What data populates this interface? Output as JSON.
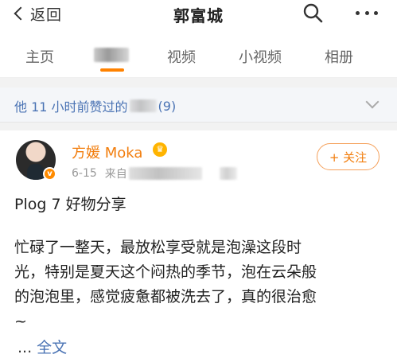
{
  "nav": {
    "back_label": "返回",
    "title": "郭富城",
    "icons": [
      "chevron-left-icon",
      "search-icon",
      "more-icon"
    ]
  },
  "tabs": [
    {
      "label": "主页"
    },
    {
      "label": "微博",
      "active": true
    },
    {
      "label": "视频"
    },
    {
      "label": "小视频"
    },
    {
      "label": "相册"
    }
  ],
  "liked_bar": {
    "text": "他 11 小时前赞过的",
    "count": "(9)"
  },
  "post": {
    "username": "方媛 Moka",
    "date": "6-15",
    "source_prefix": "来自",
    "follow_label": "+ 关注",
    "title": "Plog 7 好物分享",
    "body_lines": [
      "忙碌了一整天，最放松享受就是泡澡这段时",
      "光，特别是夏天这个闷热的季节，泡在云朵般",
      "的泡泡里，感觉疲惫都被洗去了，真的很治愈",
      "~"
    ],
    "ellipsis": "... ",
    "fulltext_label": "全文"
  },
  "colors": {
    "accent": "#ff8200",
    "link": "#4a73b4",
    "username": "#f27d0c"
  }
}
